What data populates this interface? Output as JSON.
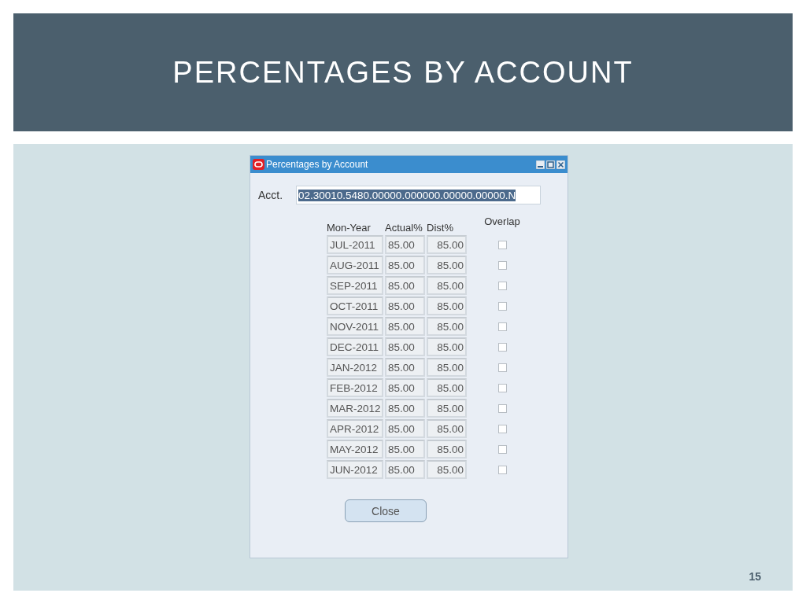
{
  "slide": {
    "title": "PERCENTAGES BY ACCOUNT",
    "page_number": "15"
  },
  "window": {
    "title": "Percentages by Account"
  },
  "account": {
    "label": "Acct.",
    "value": "02.30010.5480.00000.000000.00000.00000.N",
    "selected": true
  },
  "table": {
    "columns": [
      "Mon-Year",
      "Actual%",
      "Dist%",
      "Overlap"
    ],
    "rows": [
      {
        "month": "JUL-2011",
        "actual": "85.00",
        "dist": "85.00",
        "checked": false
      },
      {
        "month": "AUG-2011",
        "actual": "85.00",
        "dist": "85.00",
        "checked": false
      },
      {
        "month": "SEP-2011",
        "actual": "85.00",
        "dist": "85.00",
        "checked": false
      },
      {
        "month": "OCT-2011",
        "actual": "85.00",
        "dist": "85.00",
        "checked": false
      },
      {
        "month": "NOV-2011",
        "actual": "85.00",
        "dist": "85.00",
        "checked": false
      },
      {
        "month": "DEC-2011",
        "actual": "85.00",
        "dist": "85.00",
        "checked": false
      },
      {
        "month": "JAN-2012",
        "actual": "85.00",
        "dist": "85.00",
        "checked": false
      },
      {
        "month": "FEB-2012",
        "actual": "85.00",
        "dist": "85.00",
        "checked": false
      },
      {
        "month": "MAR-2012",
        "actual": "85.00",
        "dist": "85.00",
        "checked": false
      },
      {
        "month": "APR-2012",
        "actual": "85.00",
        "dist": "85.00",
        "checked": false
      },
      {
        "month": "MAY-2012",
        "actual": "85.00",
        "dist": "85.00",
        "checked": false
      },
      {
        "month": "JUN-2012",
        "actual": "85.00",
        "dist": "85.00",
        "checked": false
      }
    ]
  },
  "buttons": [
    "Close"
  ]
}
